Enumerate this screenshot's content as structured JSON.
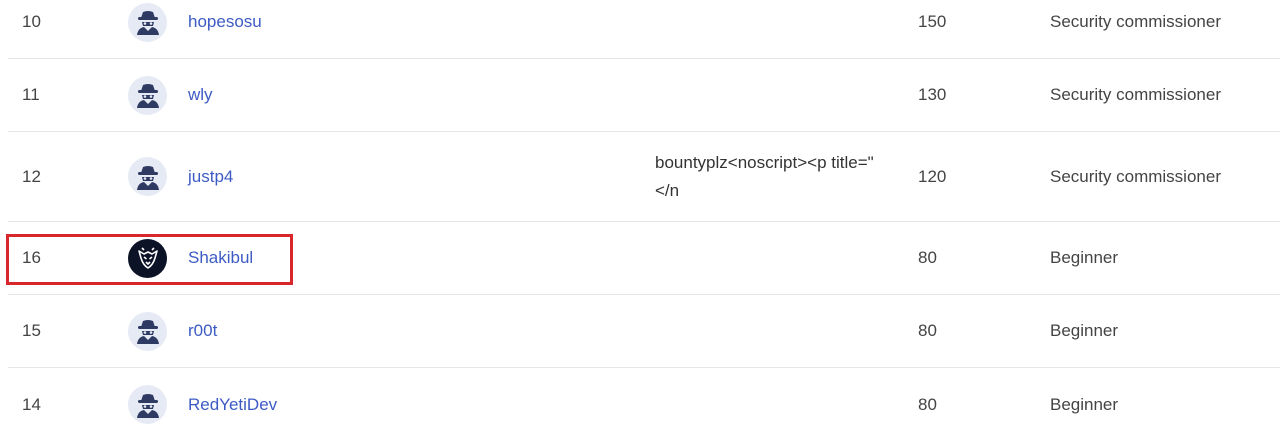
{
  "colors": {
    "link": "#3d5bc4",
    "highlight": "#d7262c",
    "divider": "#e6e6e6"
  },
  "rows": [
    {
      "rank": "10",
      "avatar": "hacker-avatar-icon",
      "username": "hopesosu",
      "bio": "",
      "points": "150",
      "title": "Security commissioner"
    },
    {
      "rank": "11",
      "avatar": "hacker-avatar-icon",
      "username": "wly",
      "bio": "",
      "points": "130",
      "title": "Security commissioner"
    },
    {
      "rank": "12",
      "avatar": "hacker-avatar-icon",
      "username": "justp4",
      "bio": "bountyplz<noscript><p title=\"</n",
      "points": "120",
      "title": "Security commissioner"
    },
    {
      "rank": "16",
      "avatar": "fox-shield-logo-icon",
      "username": "Shakibul",
      "bio": "",
      "points": "80",
      "title": "Beginner",
      "highlighted": true
    },
    {
      "rank": "15",
      "avatar": "hacker-avatar-icon",
      "username": "r00t",
      "bio": "",
      "points": "80",
      "title": "Beginner"
    },
    {
      "rank": "14",
      "avatar": "hacker-avatar-icon",
      "username": "RedYetiDev",
      "bio": "",
      "points": "80",
      "title": "Beginner"
    }
  ]
}
